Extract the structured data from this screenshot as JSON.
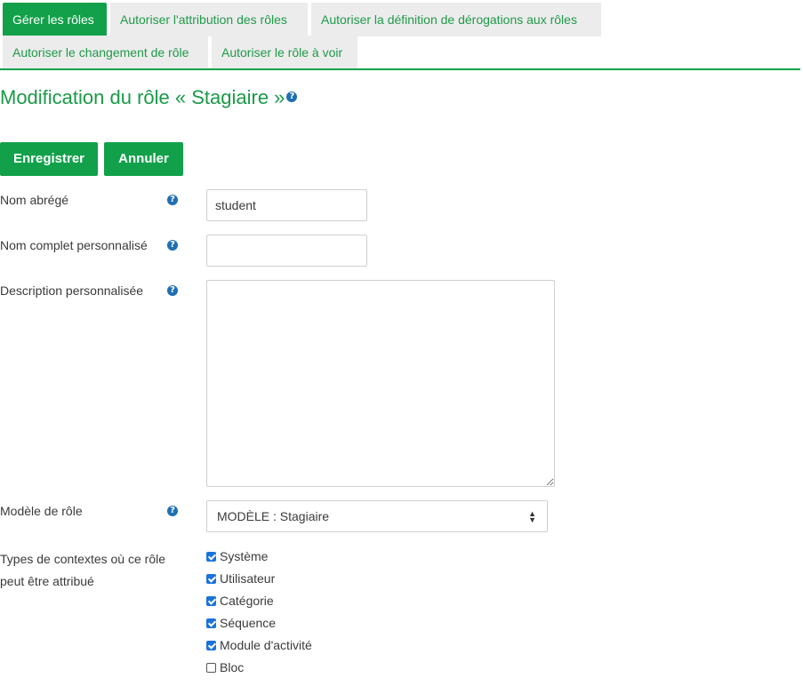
{
  "tabs": [
    {
      "label": "Gérer les rôles",
      "active": true
    },
    {
      "label": "Autoriser l'attribution des rôles",
      "active": false
    },
    {
      "label": "Autoriser la définition de dérogations aux rôles",
      "active": false
    },
    {
      "label": "Autoriser le changement de rôle",
      "active": false
    },
    {
      "label": "Autoriser le rôle à voir",
      "active": false
    }
  ],
  "page": {
    "title": "Modification du rôle « Stagiaire »"
  },
  "buttons": {
    "save": "Enregistrer",
    "cancel": "Annuler"
  },
  "form": {
    "shortname": {
      "label": "Nom abrégé",
      "value": "student"
    },
    "fullname": {
      "label": "Nom complet personnalisé",
      "value": ""
    },
    "description": {
      "label": "Description personnalisée",
      "value": ""
    },
    "archetype": {
      "label": "Modèle de rôle",
      "selected": "MODÈLE : Stagiaire"
    },
    "contexts": {
      "label": "Types de contextes où ce rôle peut être attribué",
      "items": [
        {
          "label": "Système",
          "checked": true
        },
        {
          "label": "Utilisateur",
          "checked": true
        },
        {
          "label": "Catégorie",
          "checked": true
        },
        {
          "label": "Séquence",
          "checked": true
        },
        {
          "label": "Module d'activité",
          "checked": true
        },
        {
          "label": "Bloc",
          "checked": false
        }
      ]
    }
  },
  "icons": {
    "help": "question-circle-icon",
    "select_arrows": "sort-arrows-icon"
  },
  "colors": {
    "accent": "#12a14a",
    "tab_bg": "#ececec",
    "help_icon": "#1f6fb2",
    "checkbox": "#1a73d9"
  }
}
